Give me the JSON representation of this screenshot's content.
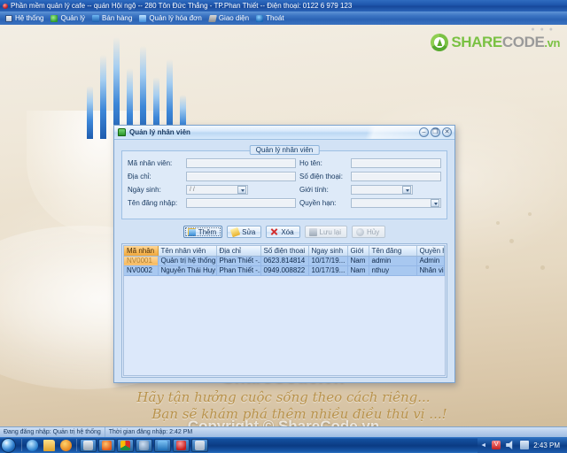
{
  "window": {
    "title": "Phần mềm quản lý cafe -- quán Hội ngộ -- 280 Tôn Đức Thắng - TP.Phan Thiết -- Điện thoại: 0122 6 979 123"
  },
  "menubar": {
    "items": [
      {
        "label": "Hệ thống",
        "icon": "system-icon"
      },
      {
        "label": "Quản lý",
        "icon": "manage-icon"
      },
      {
        "label": "Bán hàng",
        "icon": "sales-icon"
      },
      {
        "label": "Quản lý hóa đơn",
        "icon": "invoice-icon"
      },
      {
        "label": "Giao diện",
        "icon": "interface-icon"
      },
      {
        "label": "Thoát",
        "icon": "exit-icon"
      }
    ]
  },
  "branding": {
    "logo_share": "SHARE",
    "logo_code": "CODE",
    "logo_vn": ".vn",
    "watermark": "ShareCode.vn",
    "copyright": "Copyright © ShareCode.vn",
    "script_line1": "Hãy tận hưởng cuộc sống theo cách riêng...",
    "script_line2": "Bạn sẽ khám phá thêm nhiều điều thú vị ...!"
  },
  "dialog": {
    "title": "Quản lý nhân viên",
    "groupbox_title": "Quản lý nhân viên",
    "buttons": {
      "minimize": "–",
      "maximize": "❐",
      "close": "✕"
    },
    "fields": [
      {
        "label": "Mã nhân viên:",
        "value": "",
        "type": "text"
      },
      {
        "label": "Họ tên:",
        "value": "",
        "type": "text"
      },
      {
        "label": "Địa chỉ:",
        "value": "",
        "type": "text"
      },
      {
        "label": "Số điện thoại:",
        "value": "",
        "type": "text"
      },
      {
        "label": "Ngày sinh:",
        "value": "  /    /",
        "type": "datepicker"
      },
      {
        "label": "Giới tính:",
        "value": "",
        "type": "combo"
      },
      {
        "label": "Tên đăng nhập:",
        "value": "",
        "type": "text"
      },
      {
        "label": "Quyền hạn:",
        "value": "",
        "type": "combo"
      }
    ],
    "toolbar": [
      {
        "label": "Thêm",
        "icon": "add-icon",
        "state": "focused"
      },
      {
        "label": "Sửa",
        "icon": "edit-icon",
        "state": "enabled"
      },
      {
        "label": "Xóa",
        "icon": "delete-icon",
        "state": "enabled"
      },
      {
        "label": "Lưu lại",
        "icon": "save-icon",
        "state": "disabled"
      },
      {
        "label": "Hủy",
        "icon": "cancel-icon",
        "state": "disabled"
      }
    ],
    "grid": {
      "columns": [
        "Mã nhân",
        "Tên nhân viên",
        "Địa chỉ",
        "Số điện thoai",
        "Ngay sinh",
        "Giới",
        "Tên đăng",
        "Quyền han"
      ],
      "rows": [
        {
          "selected_cell": 0,
          "cells": [
            "NV0001",
            "Quản trị hệ thống",
            "Phan Thiết -...",
            "0623.814814",
            "10/17/19...",
            "Nam",
            "admin",
            "Admin"
          ]
        },
        {
          "selected_cell": -1,
          "cells": [
            "NV0002",
            "Nguyễn Thái Huy",
            "Phan Thiết -...",
            "0949.008822",
            "10/17/19...",
            "Nam",
            "nthuy",
            "Nhân viên"
          ]
        }
      ]
    }
  },
  "statusbar": {
    "login_user": "Đang đăng nhập: Quản trị hệ thống",
    "login_time": "Thời gian đăng nhập: 2:42 PM"
  },
  "taskbar": {
    "start": "start-orb",
    "clock": "2:43 PM",
    "icons": [
      "internet-explorer-icon",
      "file-explorer-icon",
      "media-player-icon"
    ],
    "tasks": [
      "save-app-icon",
      "firefox-icon",
      "chrome-icon",
      "tool-icon",
      "skype-icon",
      "cafe-app-icon",
      "window-icon"
    ],
    "tray": [
      "show-hidden-icons-arrow",
      "unikey-icon",
      "volume-icon",
      "network-icon"
    ]
  },
  "colors": {
    "accent": "#1d55ab",
    "brand_green": "#7ac143",
    "selection": "#f5b75b",
    "grid_row": "#a8c8f0"
  }
}
